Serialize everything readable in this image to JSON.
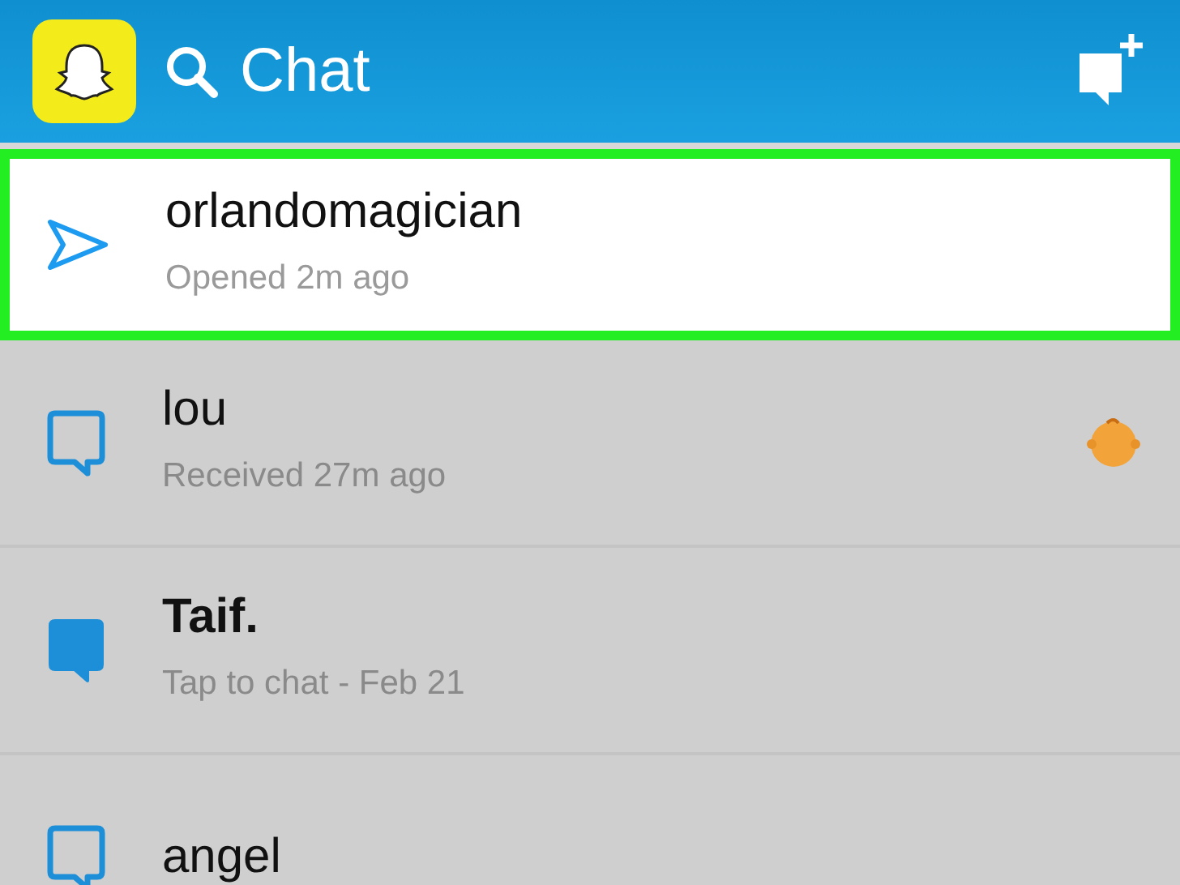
{
  "header": {
    "title": "Chat"
  },
  "chats": [
    {
      "name": "orlandomagician",
      "status": "Opened 2m ago",
      "kind": "sent",
      "selected": true,
      "unread": false,
      "emoji": false
    },
    {
      "name": "lou",
      "status": "Received 27m ago",
      "kind": "outline",
      "selected": false,
      "unread": false,
      "emoji": true
    },
    {
      "name": "Taif.",
      "status": "Tap to chat - Feb 21",
      "kind": "filled",
      "selected": false,
      "unread": true,
      "emoji": false
    },
    {
      "name": "angel",
      "kind": "outline",
      "selected": false,
      "unread": false,
      "emoji": false
    }
  ]
}
